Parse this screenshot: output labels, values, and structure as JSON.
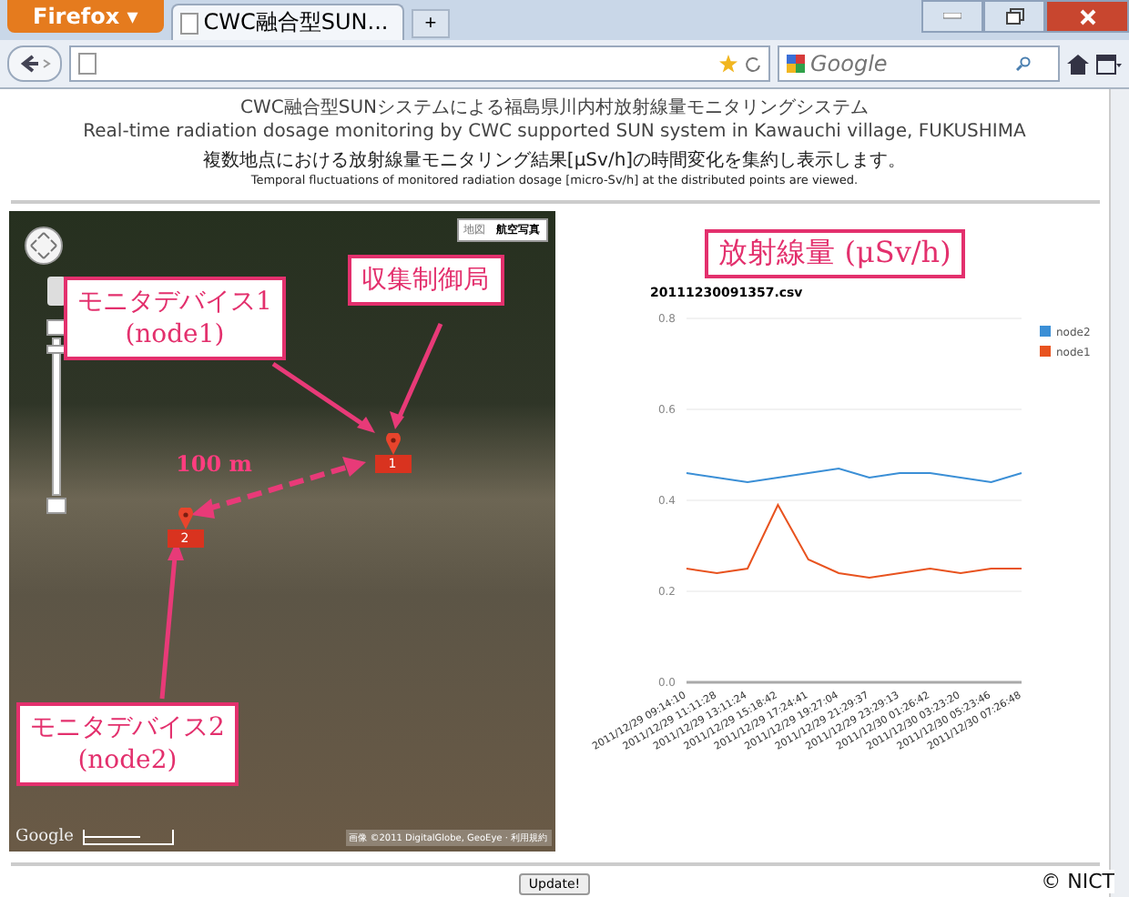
{
  "browser": {
    "menu_button": "Firefox ▾",
    "tab_title": "CWC融合型SUN...",
    "new_tab": "+",
    "search_placeholder": "Google"
  },
  "header": {
    "title_ja": "CWC融合型SUNシステムによる福島県川内村放射線量モニタリングシステム",
    "title_en": "Real-time radiation dosage monitoring by CWC supported SUN system in Kawauchi village, FUKUSHIMA",
    "subtitle_ja": "複数地点における放射線量モニタリング結果[μSv/h]の時間変化を集約し表示します。",
    "subtitle_en": "Temporal fluctuations of monitored radiation dosage [micro-Sv/h] at the distributed points are viewed."
  },
  "map": {
    "map_types": [
      {
        "label": "地図",
        "selected": false
      },
      {
        "label": "航空写真",
        "selected": true
      }
    ],
    "markers": [
      {
        "label": "1"
      },
      {
        "label": "2"
      }
    ],
    "callouts": [
      {
        "lines": [
          "モニタデバイス1",
          "(node1)"
        ]
      },
      {
        "lines": [
          "収集制御局"
        ]
      },
      {
        "lines": [
          "モニタデバイス2",
          "(node2)"
        ]
      }
    ],
    "distance": "100 m",
    "logo": "Google",
    "copyright": "画像 ©2011 DigitalGlobe, GeoEye · 利用規約"
  },
  "chart_panel": {
    "heading": "放射線量 (μSv/h)",
    "chart_data": {
      "type": "line",
      "title": "20111230091357.csv",
      "grid": true,
      "legend": true,
      "categories": [
        "2011/12/29 09:14:10",
        "2011/12/29 11:11:28",
        "2011/12/29 13:11:24",
        "2011/12/29 15:18:42",
        "2011/12/29 17:24:41",
        "2011/12/29 19:27:04",
        "2011/12/29 21:29:37",
        "2011/12/29 23:29:13",
        "2011/12/30 01:26:42",
        "2011/12/30 03:23:20",
        "2011/12/30 05:23:46",
        "2011/12/30 07:26:48"
      ],
      "ylim": [
        0,
        0.8
      ],
      "yticks": [
        {
          "value": 0,
          "label": "0.0"
        },
        {
          "value": 0.2,
          "label": "0.2"
        },
        {
          "value": 0.4,
          "label": "0.4"
        },
        {
          "value": 0.6,
          "label": "0.6"
        },
        {
          "value": 0.8,
          "label": "0.8"
        }
      ],
      "series": [
        {
          "name": "node2",
          "color": "#3b8fd6",
          "values": [
            0.46,
            0.45,
            0.44,
            0.45,
            0.46,
            0.47,
            0.45,
            0.46,
            0.46,
            0.45,
            0.44,
            0.46
          ]
        },
        {
          "name": "node1",
          "color": "#e8531f",
          "values": [
            0.25,
            0.24,
            0.25,
            0.39,
            0.27,
            0.24,
            0.23,
            0.24,
            0.25,
            0.24,
            0.25,
            0.25
          ]
        }
      ]
    }
  },
  "footer": {
    "update_button": "Update!",
    "credit": "© NICT"
  }
}
